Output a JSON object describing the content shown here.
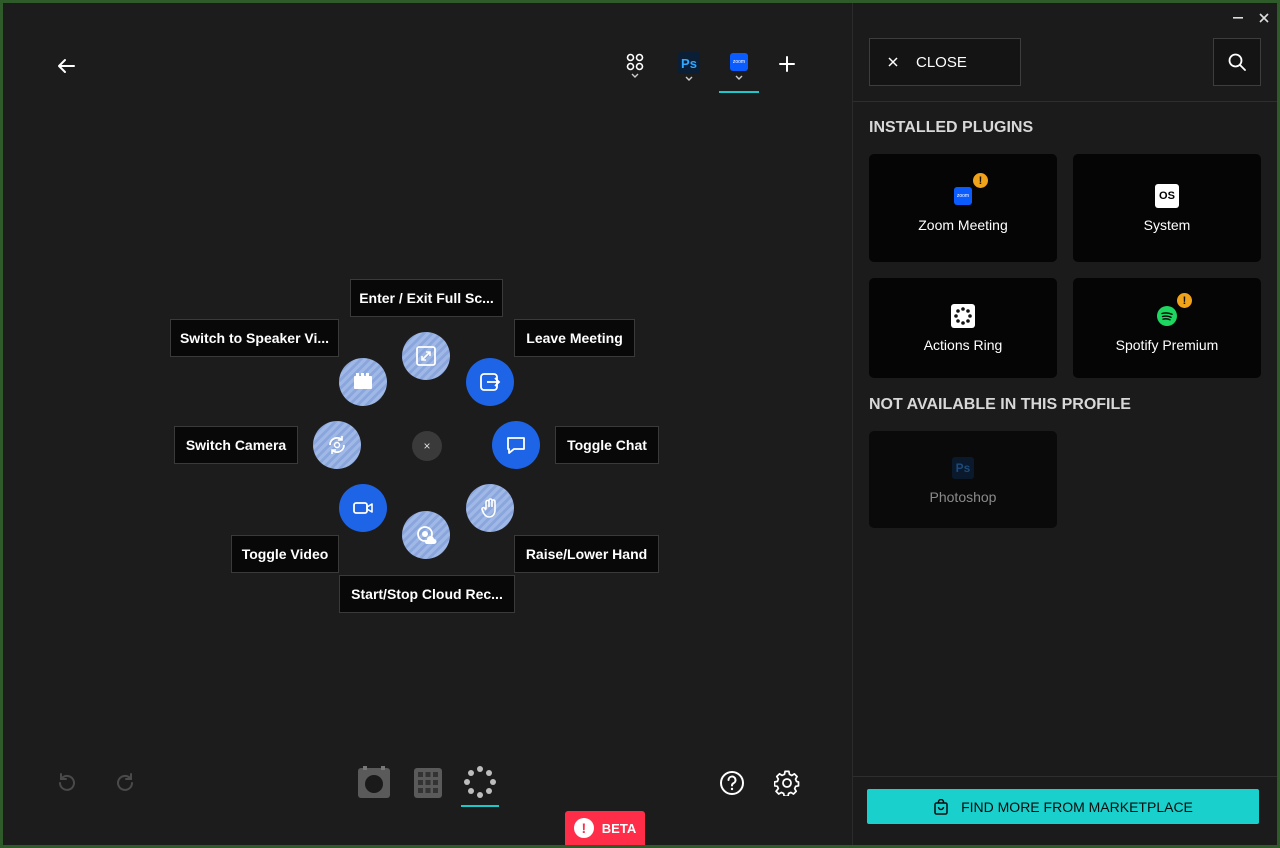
{
  "header": {
    "back_icon": "arrow-left-icon",
    "profiles": [
      {
        "name": "default-profile",
        "icon": "grid-dots-icon"
      },
      {
        "name": "photoshop",
        "badge": "Ps"
      },
      {
        "name": "zoom",
        "badge": "zoom",
        "active": true
      }
    ],
    "add_icon": "plus-icon"
  },
  "ring": {
    "labels": {
      "fullscreen": "Enter / Exit Full Sc...",
      "leave": "Leave Meeting",
      "speaker": "Switch to Speaker Vi...",
      "camera": "Switch Camera",
      "chat": "Toggle Chat",
      "video": "Toggle Video",
      "hand": "Raise/Lower Hand",
      "record": "Start/Stop Cloud Rec..."
    },
    "center": "×"
  },
  "bottom": {
    "beta": "BETA",
    "beta_icon": "!"
  },
  "side": {
    "close_label": "CLOSE",
    "installed_title": "INSTALLED PLUGINS",
    "plugins": [
      {
        "name": "Zoom Meeting",
        "warning": "!"
      },
      {
        "name": "System",
        "badge": "OS"
      },
      {
        "name": "Actions Ring"
      },
      {
        "name": "Spotify Premium",
        "warning": "!"
      }
    ],
    "unavailable_title": "NOT AVAILABLE IN THIS PROFILE",
    "unavailable": [
      {
        "name": "Photoshop",
        "badge": "Ps"
      }
    ],
    "marketplace": "FIND MORE FROM MARKETPLACE"
  },
  "colors": {
    "accent": "#1ad0cc",
    "ring_blue": "#1e64e6",
    "beta_red": "#ff2d48",
    "warning": "#f0a21a"
  }
}
